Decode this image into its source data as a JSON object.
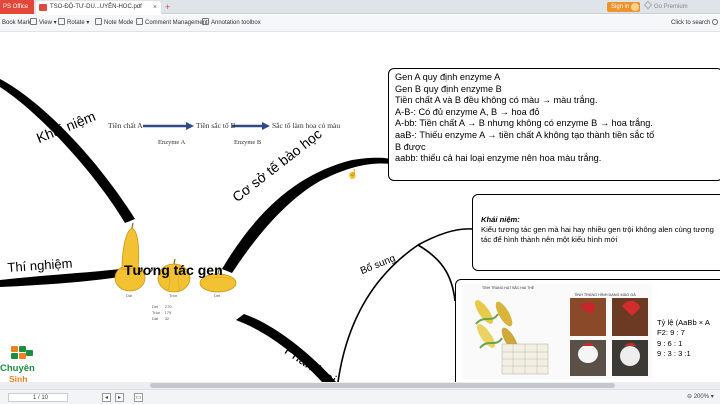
{
  "titlebar": {
    "app_tab": "PS Office",
    "doc_tab": "TSO-ĐỘ-TƯ-DU...UYÊN-HOC.pdf",
    "sign_in": "Sign in",
    "premium": "Go Premium"
  },
  "toolbar": {
    "items": [
      "Book Mark",
      "View",
      "Rotate",
      "Note Mode",
      "Comment Management",
      "Annotation toolbox"
    ],
    "search": "Click to search"
  },
  "mindmap": {
    "center": "Tương tác gen",
    "branch_definition": "Khái niệm",
    "branch_experiment": "Thí nghiệm",
    "branch_cell_basis": "Cơ sở tế bào học",
    "branch_supplement": "Bổ sung",
    "branch_classification": "Phân loại"
  },
  "diagram": {
    "precursor": "Tiền chất A",
    "intermediate": "Tiền sắc tố B",
    "pigment": "Sắc tố làm hoa có màu",
    "enzyme_a": "Enzyme A",
    "enzyme_b": "Enzyme B"
  },
  "squash_labels": [
    "Dài",
    "Tròn",
    "Dẹt"
  ],
  "squash_counts": [
    {
      "name": "Dẹt",
      "value": "270"
    },
    {
      "name": "Tròn",
      "value": "179"
    },
    {
      "name": "Dài",
      "value": "32"
    }
  ],
  "cell_basis_box": {
    "lines": [
      "Gen A quy định enzyme A",
      "Gen B quy định enzyme B",
      "Tiền chất A và B đều không có màu → màu trắng.",
      "A-B-: Có đủ enzyme A, B → hoa đỏ",
      "A-bb: Tiền chất A → B nhưng không có enzyme B → hoa trắng.",
      "aaB-: Thiếu enzyme A → tiền chất A không tạo thành tiền sắc tố",
      "B được",
      "aabb: thiếu cả hai loại enzyme nên hoa màu trắng."
    ]
  },
  "supplement_box": {
    "title": "Khái niệm:",
    "body": "Kiểu tương tác gen mà hai hay nhiều gen trội không alen cùng tương tác để hình thành nên một kiểu hình mới"
  },
  "classification_box": {
    "panel_title_1": "TÍNH TRẠNG HẠT BẮC HAI THỂ",
    "panel_title_2": "TÍNH TRẠNG HÌNH DẠNG MÀO GÀ",
    "ratio_lines": [
      "Tỷ lệ (AaBb × A",
      "F2: 9 : 7",
      "9 : 6 : 1",
      "9 : 3 : 3 :1"
    ]
  },
  "statusbar": {
    "page": "1 / 10",
    "zoom": "200%"
  },
  "logo": {
    "line1": "Chuyên",
    "line2": "Sinh"
  },
  "colors": {
    "app_red": "#e4473a",
    "signin_orange": "#f0922a",
    "squash_yellow": "#f2c232",
    "logo_green": "#1c8f3f",
    "logo_orange": "#f07f22",
    "arrow_blue": "#2e4a86"
  }
}
